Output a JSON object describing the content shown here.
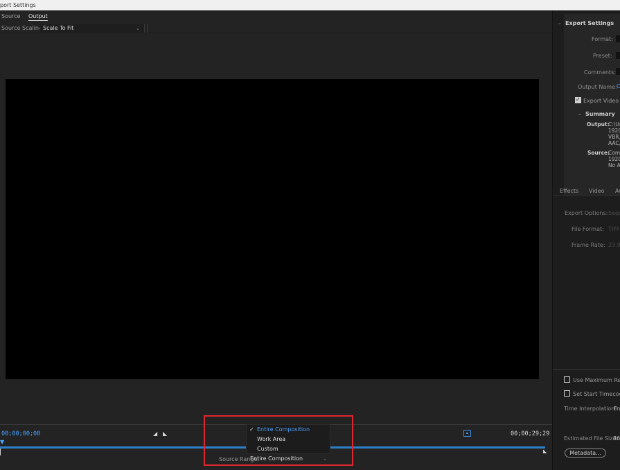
{
  "window": {
    "title": "port Settings"
  },
  "tabs": [
    {
      "label": "Source"
    },
    {
      "label": "Output"
    }
  ],
  "source_scaling": {
    "label": "Source Scaling:",
    "value": "Scale To Fit"
  },
  "timeline": {
    "start_timecode": "00;00;00;00",
    "end_timecode": "00;00;29;29"
  },
  "source_range": {
    "label": "Source Range:",
    "value": "Entire Composition",
    "options": [
      {
        "label": "Entire Composition",
        "selected": true
      },
      {
        "label": "Work Area",
        "selected": false
      },
      {
        "label": "Custom",
        "selected": false
      }
    ]
  },
  "export_settings": {
    "title": "Export Settings",
    "format_label": "Format:",
    "preset_label": "Preset:",
    "comments_label": "Comments:",
    "output_name_label": "Output Name:",
    "output_name_value": "C",
    "export_video_label": "Export Video",
    "export_video_checked": true
  },
  "summary": {
    "title": "Summary",
    "output_key": "Output:",
    "output_lines": [
      "C:\\Use",
      "1920x",
      "VBR, ",
      "AAC, "
    ],
    "source_key": "Source:",
    "source_lines": [
      "Comp",
      "1920x",
      "No Au"
    ]
  },
  "right_tabs": [
    {
      "label": "Effects"
    },
    {
      "label": "Video"
    },
    {
      "label": "Au"
    }
  ],
  "options": {
    "export_options_label": "Export Options:",
    "export_options_value": "Seque",
    "file_format_label": "File Format:",
    "file_format_value": "TIFF",
    "frame_rate_label": "Frame Rate:",
    "frame_rate_value": "23.976"
  },
  "bottom": {
    "use_max_render_label": "Use Maximum Rende",
    "set_start_timecode_label": "Set Start Timecode",
    "time_interp_label": "Time Interpolation:",
    "time_interp_value": "Fra",
    "est_file_size_label": "Estimated File Size:",
    "est_file_size_value": "36",
    "metadata_button": "Metadata..."
  },
  "colors": {
    "accent_blue": "#4aa3ff",
    "track_blue": "#2c7fc9",
    "highlight_red": "#e0262f",
    "preview_black": "#000000"
  }
}
